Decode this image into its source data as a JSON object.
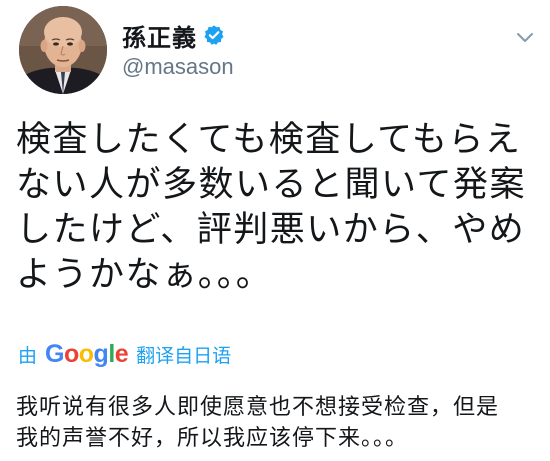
{
  "user": {
    "display_name": "孫正義",
    "handle": "@masason",
    "verified": true
  },
  "tweet": {
    "text": "検査したくても検査してもらえ\nない人が多数いると聞いて発案\nしたけど、評判悪いから、やめ\nようかなぁ。。。"
  },
  "translation": {
    "prefix": "由",
    "provider_letters": [
      "G",
      "o",
      "o",
      "g",
      "l",
      "e"
    ],
    "suffix": "翻译自日语",
    "text": "我听说有很多人即使愿意也不想接受检查，但是\n我的声誉不好，所以我应该停下来。。。"
  },
  "colors": {
    "link_blue": "#1da1f2",
    "verified_blue": "#1da1f2",
    "handle_gray": "#657786",
    "google_blue": "#4285f4",
    "google_red": "#ea4335",
    "google_yellow": "#fbbc05",
    "google_green": "#34a853"
  },
  "icons": {
    "verified": "verified-badge-icon",
    "caret": "chevron-down-icon"
  }
}
